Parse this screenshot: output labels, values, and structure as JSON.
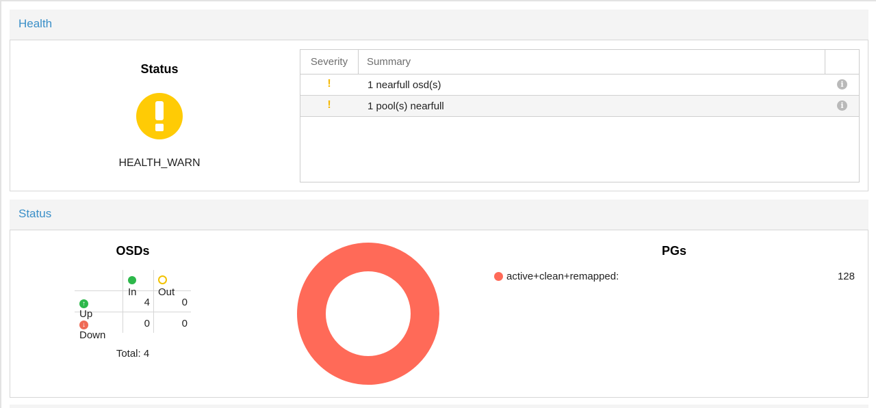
{
  "health": {
    "title": "Health",
    "status_title": "Status",
    "status_value": "HEALTH_WARN",
    "status_color": "#ffcb05",
    "status_icon": "exclamation-icon",
    "table": {
      "col_severity": "Severity",
      "col_summary": "Summary",
      "rows": [
        {
          "severity_icon": "!",
          "summary": "1 nearfull osd(s)",
          "info_icon": "i"
        },
        {
          "severity_icon": "!",
          "summary": "1 pool(s) nearfull",
          "info_icon": "i"
        }
      ]
    }
  },
  "status": {
    "title": "Status",
    "osds": {
      "title": "OSDs",
      "col_in": "In",
      "col_out": "Out",
      "row_up": "Up",
      "row_down": "Down",
      "up_in": "4",
      "up_out": "0",
      "down_in": "0",
      "down_out": "0",
      "total": "Total: 4",
      "colors": {
        "in": "#2db84b",
        "out": "#f2c200",
        "up": "#2db84b",
        "down": "#ef6a55"
      }
    },
    "pgs": {
      "title": "PGs",
      "items": [
        {
          "label": "active+clean+remapped:",
          "value": "128",
          "count": 128,
          "color": "#ff6a58"
        }
      ]
    }
  },
  "colors": {
    "accent": "#3a8fc8",
    "warn": "#f5b800"
  }
}
